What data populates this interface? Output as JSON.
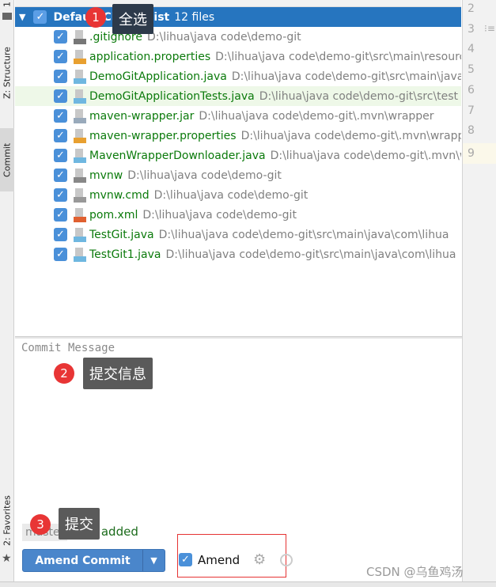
{
  "sidebar": {
    "tabs": [
      {
        "label": "1"
      },
      {
        "label": "Z: Structure"
      },
      {
        "label": "Commit"
      },
      {
        "label": "2: Favorites"
      }
    ]
  },
  "changelist": {
    "name": "Default Changelist",
    "count": "12 files",
    "files": [
      {
        "name": ".gitignore",
        "path": "D:\\lihua\\java code\\demo-git",
        "icon": "ignore-file-icon"
      },
      {
        "name": "application.properties",
        "path": "D:\\lihua\\java code\\demo-git\\src\\main\\resources",
        "icon": "properties-file-icon"
      },
      {
        "name": "DemoGitApplication.java",
        "path": "D:\\lihua\\java code\\demo-git\\src\\main\\java",
        "icon": "java-file-icon"
      },
      {
        "name": "DemoGitApplicationTests.java",
        "path": "D:\\lihua\\java code\\demo-git\\src\\test",
        "icon": "java-file-icon"
      },
      {
        "name": "maven-wrapper.jar",
        "path": "D:\\lihua\\java code\\demo-git\\.mvn\\wrapper",
        "icon": "jar-file-icon"
      },
      {
        "name": "maven-wrapper.properties",
        "path": "D:\\lihua\\java code\\demo-git\\.mvn\\wrapper",
        "icon": "properties-file-icon"
      },
      {
        "name": "MavenWrapperDownloader.java",
        "path": "D:\\lihua\\java code\\demo-git\\.mvn\\wrapper",
        "icon": "java-file-icon"
      },
      {
        "name": "mvnw",
        "path": "D:\\lihua\\java code\\demo-git",
        "icon": "shell-file-icon"
      },
      {
        "name": "mvnw.cmd",
        "path": "D:\\lihua\\java code\\demo-git",
        "icon": "text-file-icon"
      },
      {
        "name": "pom.xml",
        "path": "D:\\lihua\\java code\\demo-git",
        "icon": "xml-file-icon"
      },
      {
        "name": "TestGit.java",
        "path": "D:\\lihua\\java code\\demo-git\\src\\main\\java\\com\\lihua",
        "icon": "java-file-icon"
      },
      {
        "name": "TestGit1.java",
        "path": "D:\\lihua\\java code\\demo-git\\src\\main\\java\\com\\lihua",
        "icon": "java-file-icon"
      }
    ]
  },
  "gutter": {
    "lines": [
      "2",
      "3",
      "4",
      "5",
      "6",
      "7",
      "8",
      "9"
    ]
  },
  "commit": {
    "placeholder": "Commit Message",
    "branch": "master",
    "status": "12 added",
    "button": "Amend Commit",
    "amend_label": "Amend",
    "amend_checked": true
  },
  "annotations": [
    {
      "num": "1",
      "text": "全选"
    },
    {
      "num": "2",
      "text": "提交信息"
    },
    {
      "num": "3",
      "text": "提交"
    }
  ],
  "watermark": "CSDN @乌鱼鸡汤",
  "colors": {
    "accent": "#2675bf",
    "file_added": "#0b7a0b",
    "annotation_badge": "#e83535"
  }
}
